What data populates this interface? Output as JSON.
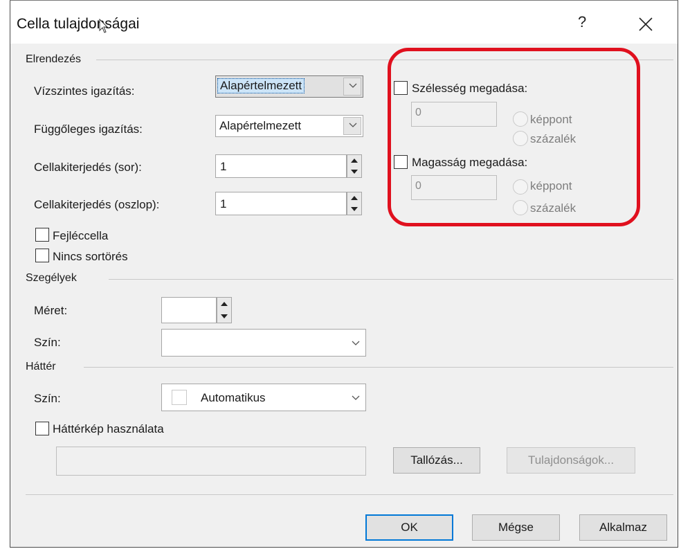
{
  "window": {
    "title": "Cella tulajdonságai",
    "help_label": "?"
  },
  "layout_group": {
    "title": "Elrendezés",
    "horizontal_label": "Vízszintes igazítás:",
    "horizontal_value": "Alapértelmezett",
    "vertical_label": "Függőleges igazítás:",
    "vertical_value": "Alapértelmezett",
    "rowspan_label": "Cellakiterjedés (sor):",
    "rowspan_value": "1",
    "colspan_label": "Cellakiterjedés (oszlop):",
    "colspan_value": "1",
    "header_cell_label": "Fejléccella",
    "no_wrap_label": "Nincs sortörés"
  },
  "size_group": {
    "width_label": "Szélesség megadása:",
    "width_value": "0",
    "height_label": "Magasság megadása:",
    "height_value": "0",
    "pixel_label": "képpont",
    "percent_label": "százalék"
  },
  "borders_group": {
    "title": "Szegélyek",
    "size_label": "Méret:",
    "color_label": "Szín:"
  },
  "background_group": {
    "title": "Háttér",
    "color_label": "Szín:",
    "color_value": "Automatikus",
    "use_image_label": "Háttérkép használata",
    "browse_label": "Tallózás...",
    "properties_label": "Tulajdonságok..."
  },
  "footer": {
    "ok_label": "OK",
    "cancel_label": "Mégse",
    "apply_label": "Alkalmaz"
  },
  "colors": {
    "highlight": "#e0101e",
    "focus_blue": "#0078d7"
  }
}
